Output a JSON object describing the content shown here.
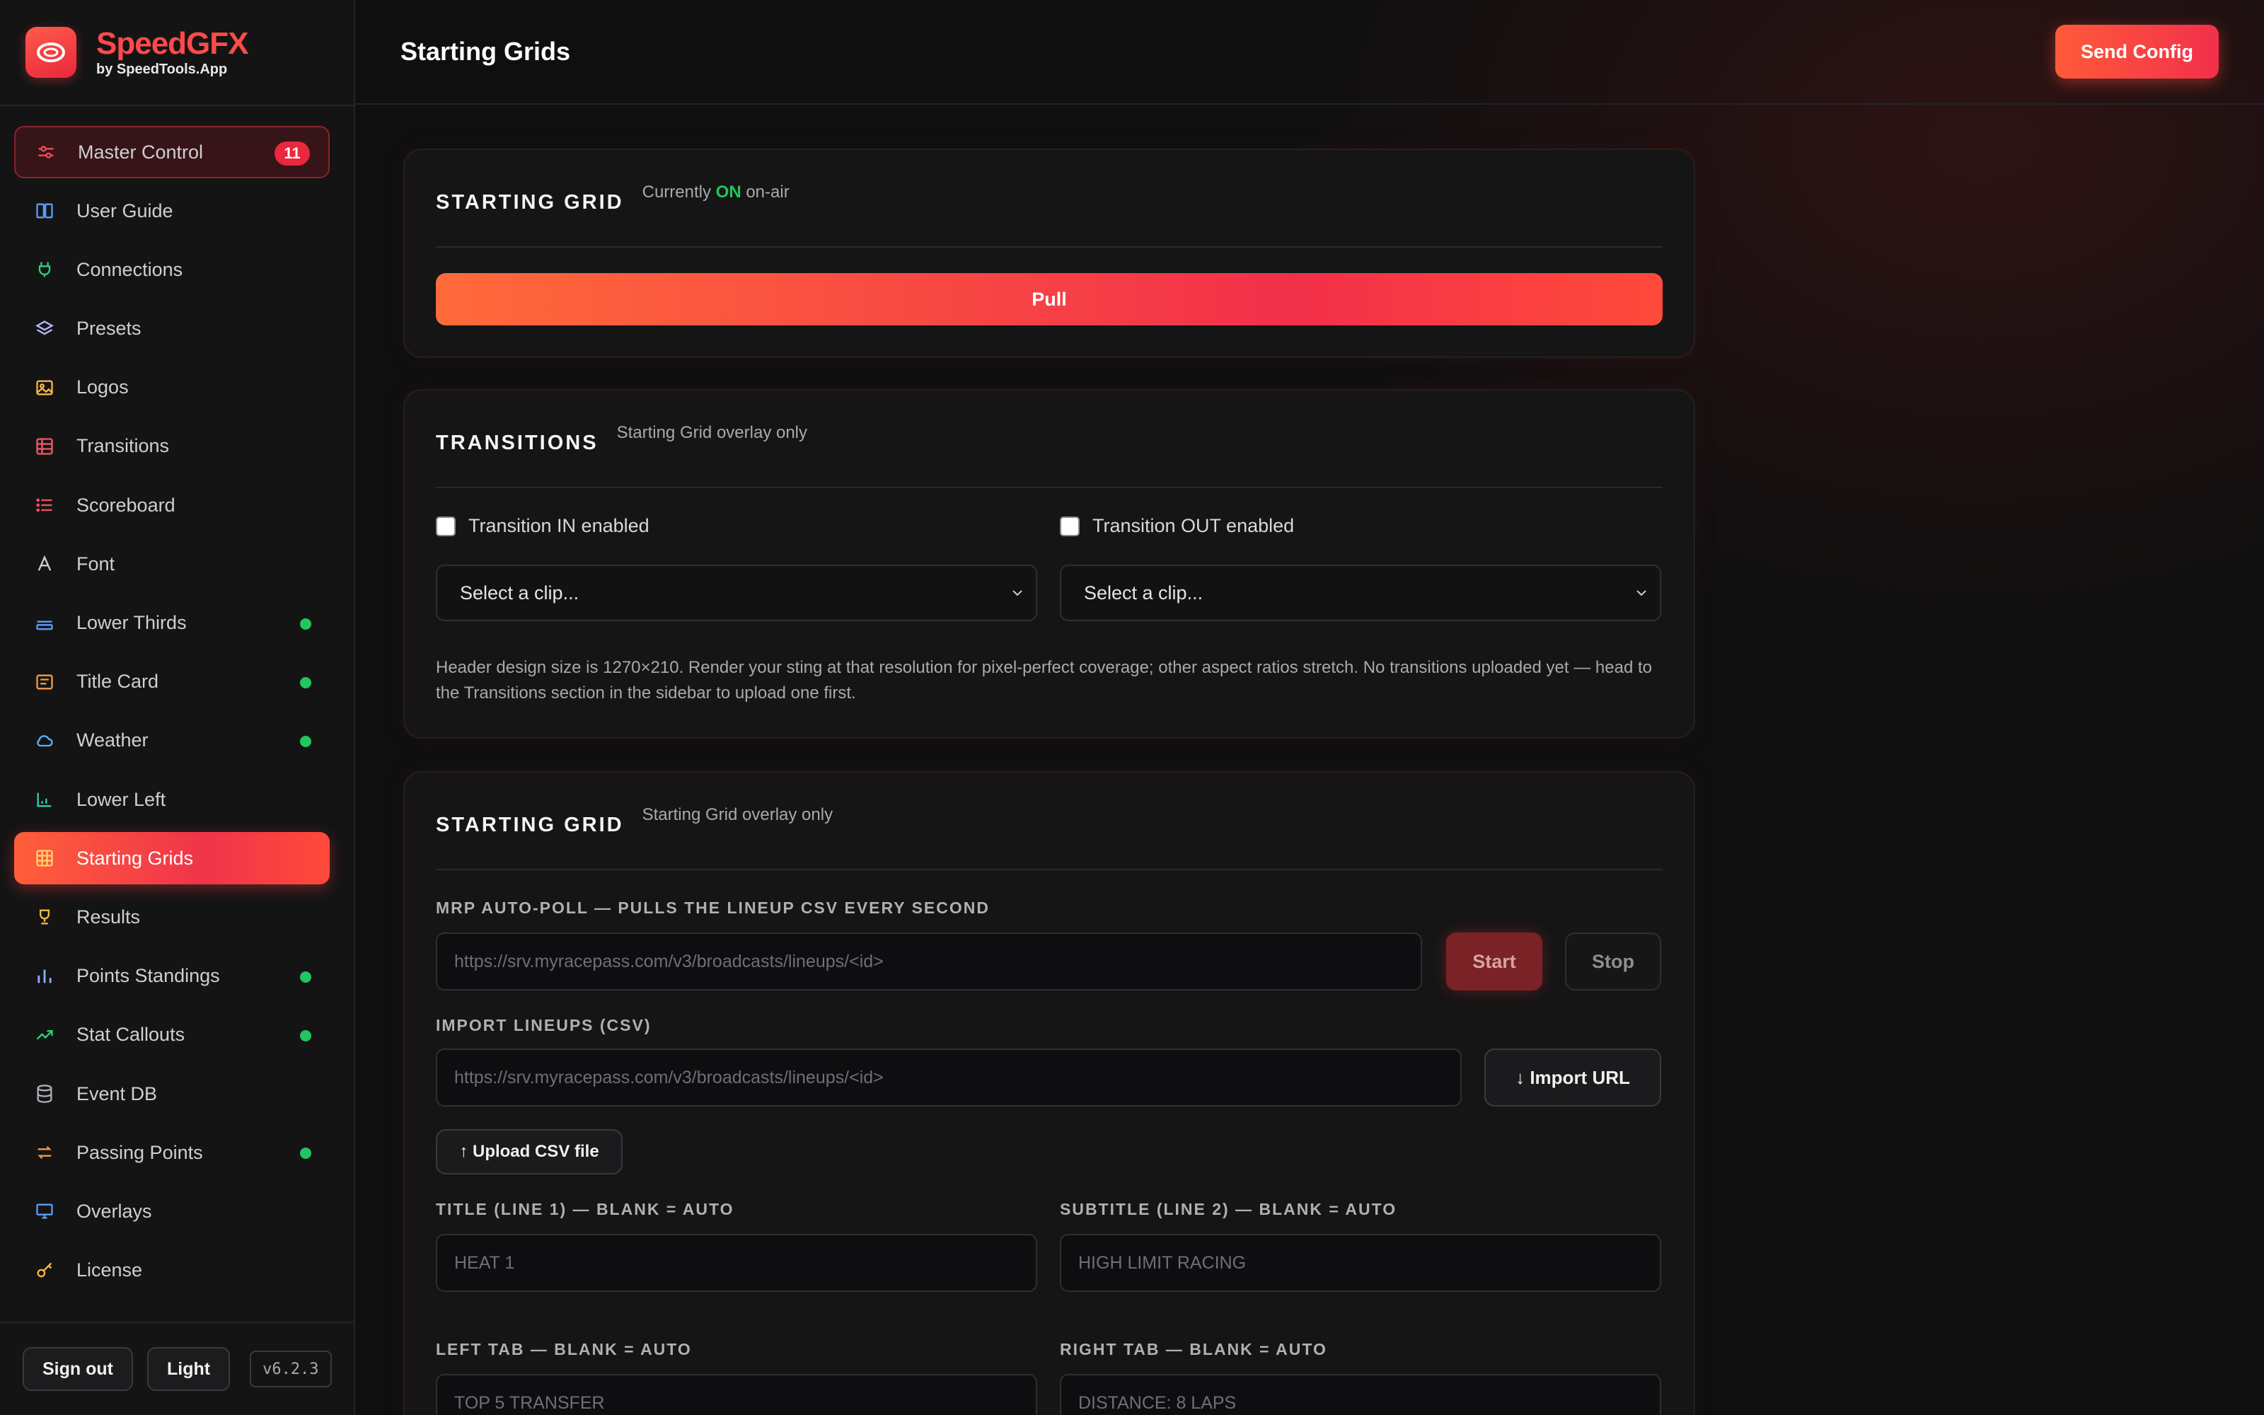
{
  "brand": {
    "name": "SpeedGFX",
    "sub": "by SpeedTools.App"
  },
  "sidebar": {
    "items": [
      {
        "label": "Master Control",
        "icon": "sliders-icon",
        "badge": "11"
      },
      {
        "label": "User Guide",
        "icon": "book-icon"
      },
      {
        "label": "Connections",
        "icon": "plug-icon"
      },
      {
        "label": "Presets",
        "icon": "layers-icon"
      },
      {
        "label": "Logos",
        "icon": "image-icon"
      },
      {
        "label": "Transitions",
        "icon": "film-icon"
      },
      {
        "label": "Scoreboard",
        "icon": "list-icon"
      },
      {
        "label": "Font",
        "icon": "font-icon"
      },
      {
        "label": "Lower Thirds",
        "icon": "lower-thirds-icon",
        "live": true
      },
      {
        "label": "Title Card",
        "icon": "title-card-icon",
        "live": true
      },
      {
        "label": "Weather",
        "icon": "cloud-icon",
        "live": true
      },
      {
        "label": "Lower Left",
        "icon": "corner-chart-icon"
      },
      {
        "label": "Starting Grids",
        "icon": "grid-icon",
        "active": true
      },
      {
        "label": "Results",
        "icon": "trophy-icon"
      },
      {
        "label": "Points Standings",
        "icon": "bar-chart-icon",
        "live": true
      },
      {
        "label": "Stat Callouts",
        "icon": "trending-up-icon",
        "live": true
      },
      {
        "label": "Event DB",
        "icon": "database-icon"
      },
      {
        "label": "Passing Points",
        "icon": "swap-icon",
        "live": true
      },
      {
        "label": "Overlays",
        "icon": "monitor-icon"
      },
      {
        "label": "License",
        "icon": "key-icon"
      }
    ],
    "footer": {
      "signout": "Sign out",
      "theme": "Light",
      "version": "v6.2.3"
    }
  },
  "header": {
    "title": "Starting Grids",
    "send_config": "Send Config"
  },
  "card1": {
    "title": "STARTING GRID",
    "status_prefix": "Currently",
    "status_value": "ON",
    "status_suffix": "on-air",
    "pull": "Pull"
  },
  "card2": {
    "title": "TRANSITIONS",
    "sub": "Starting Grid overlay only",
    "in_label": "Transition IN enabled",
    "out_label": "Transition OUT enabled",
    "in_select": "Select a clip...",
    "out_select": "Select a clip...",
    "help": "Header design size is 1270×210. Render your sting at that resolution for pixel-perfect coverage; other aspect ratios stretch. No transitions uploaded yet — head to the Transitions section in the sidebar to upload one first."
  },
  "card3": {
    "title": "STARTING GRID",
    "sub": "Starting Grid overlay only",
    "autopoll_label": "MRP AUTO-POLL — PULLS THE LINEUP CSV EVERY SECOND",
    "autopoll_placeholder": "https://srv.myracepass.com/v3/broadcasts/lineups/<id>",
    "start": "Start",
    "stop": "Stop",
    "import_label": "IMPORT LINEUPS (CSV)",
    "import_placeholder": "https://srv.myracepass.com/v3/broadcasts/lineups/<id>",
    "import_url": "↓ Import URL",
    "upload_csv": "↑ Upload CSV file",
    "title_label": "TITLE (LINE 1) — BLANK = AUTO",
    "title_placeholder": "HEAT 1",
    "subtitle_label": "SUBTITLE (LINE 2) — BLANK = AUTO",
    "subtitle_placeholder": "HIGH LIMIT RACING",
    "lefttab_label": "LEFT TAB — BLANK = AUTO",
    "lefttab_placeholder": "TOP 5 TRANSFER",
    "righttab_label": "RIGHT TAB — BLANK = AUTO",
    "righttab_placeholder": "DISTANCE: 8 LAPS"
  },
  "colors": {
    "accent": "#f2304a",
    "live": "#22c55e"
  }
}
